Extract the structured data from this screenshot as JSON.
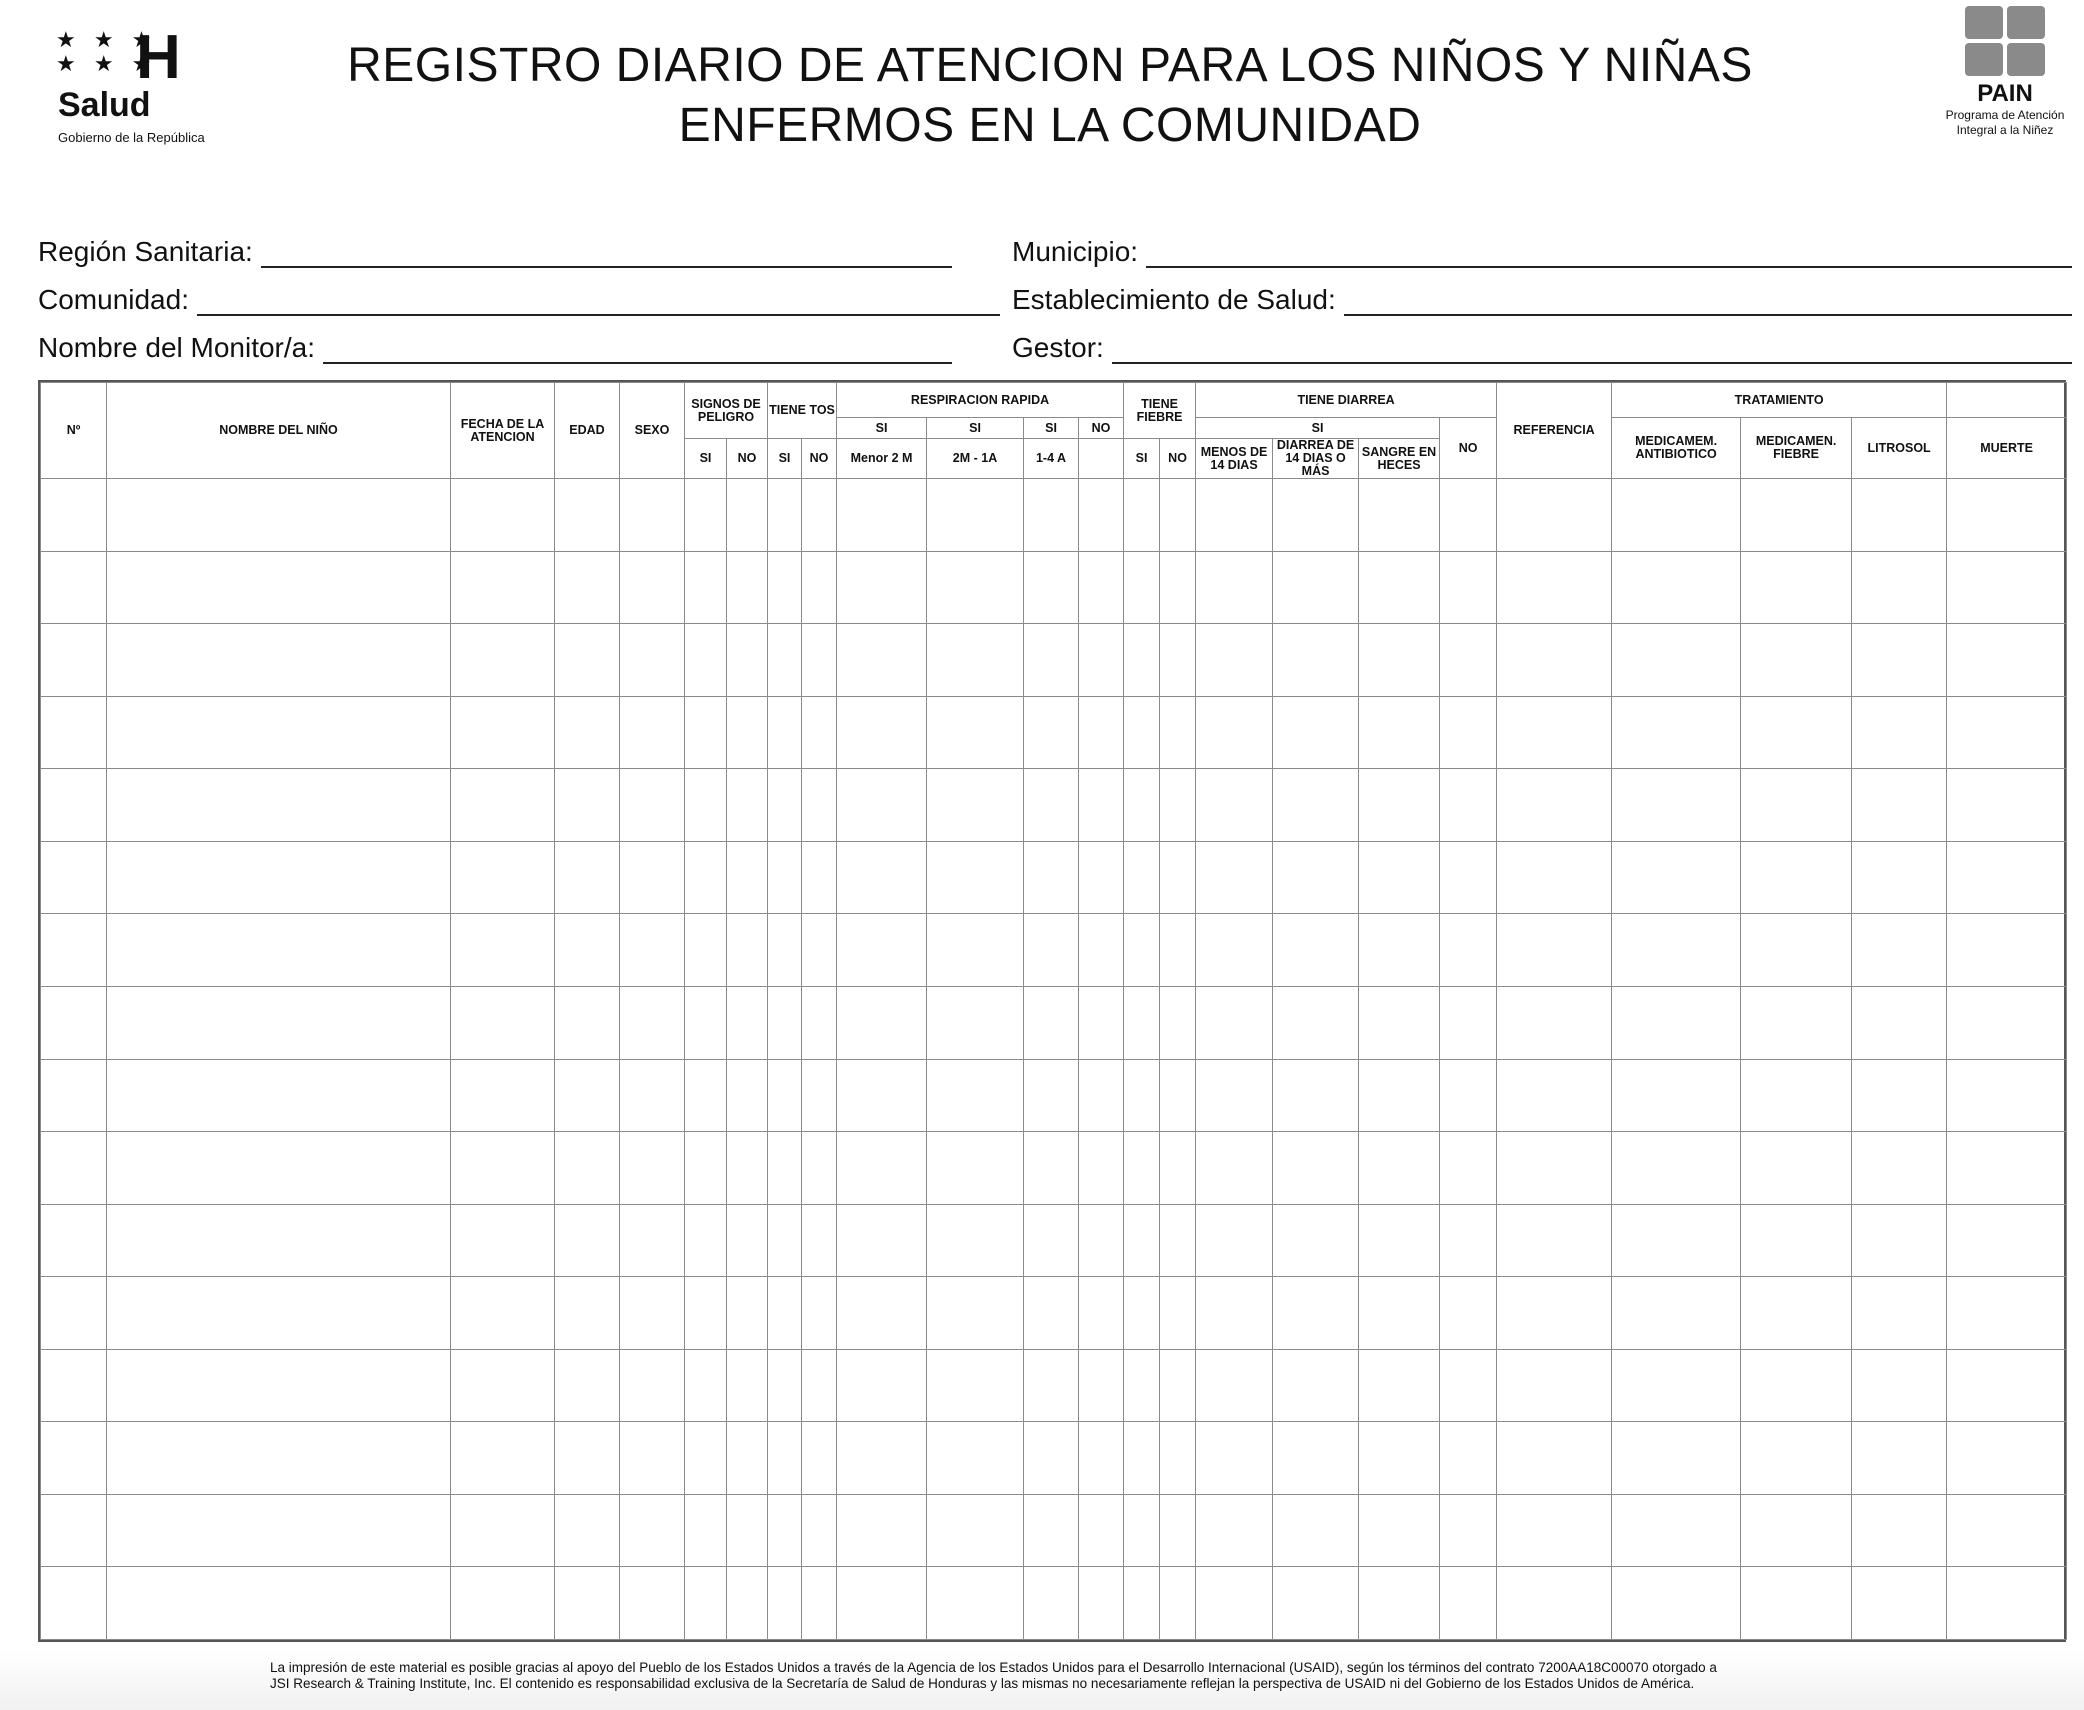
{
  "header": {
    "left_logo": {
      "stars": [
        "★ ★ ★",
        "★ ★ ★"
      ],
      "letter": "H",
      "name": "Salud",
      "subtitle": "Gobierno de la República"
    },
    "title_line1": "REGISTRO DIARIO DE ATENCION PARA LOS NIÑOS Y NIÑAS",
    "title_line2": "ENFERMOS EN LA COMUNIDAD",
    "right_logo": {
      "name": "PAIN",
      "subtitle_line1": "Programa de Atención",
      "subtitle_line2": "Integral a la Niñez"
    }
  },
  "fields": {
    "region": "Región Sanitaria:",
    "municipio": "Municipio:",
    "comunidad": "Comunidad:",
    "establecimiento": "Establecimiento de Salud:",
    "monitor": "Nombre del Monitor/a:",
    "gestor": "Gestor:"
  },
  "table": {
    "headers": {
      "num": "Nº",
      "nombre": "NOMBRE DEL NIÑO",
      "fecha": "FECHA DE LA ATENCION",
      "edad": "EDAD",
      "sexo": "SEXO",
      "signos": "SIGNOS DE PELIGRO",
      "tiene_tos": "TIENE TOS",
      "respiracion": "RESPIRACION RAPIDA",
      "tiene_fiebre": "TIENE FIEBRE",
      "tiene_diarrea": "TIENE DIARREA",
      "referencia": "REFERENCIA",
      "tratamiento": "TRATAMIENTO",
      "muerte": "MUERTE"
    },
    "sub": {
      "si": "SI",
      "no": "NO",
      "resp_menor2m": "Menor 2 M",
      "resp_2m1a": "2M - 1A",
      "resp_14a": "1-4 A",
      "diarrea_si": "SI",
      "diarrea_menos14": "MENOS DE 14 DIAS",
      "diarrea_14mas": "DIARREA DE 14 DIAS O MÁS",
      "diarrea_sangre": "SANGRE EN HECES",
      "diarrea_no": "NO",
      "trat_antibiotico": "MEDICAMEM. ANTIBIOTICO",
      "trat_fiebre": "MEDICAMEN. FIEBRE",
      "trat_litrosol": "LITROSOL"
    },
    "empty_row_count": 16
  },
  "footer": {
    "line1": "La impresión de este material es posible gracias al apoyo del Pueblo de los Estados Unidos a través de la Agencia de los Estados Unidos para el Desarrollo Internacional (USAID), según los términos del contrato 7200AA18C00070 otorgado a",
    "line2": "JSI Research & Training Institute, Inc. El contenido es responsabilidad exclusiva de la Secretaría de Salud de Honduras y las mismas no necesariamente reflejan la perspectiva de USAID ni del Gobierno de los Estados Unidos de América."
  }
}
